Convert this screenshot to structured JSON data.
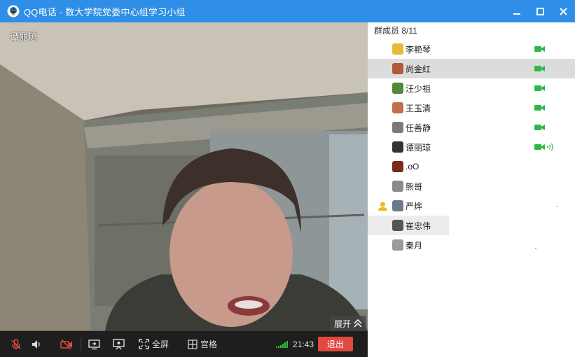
{
  "window": {
    "app": "QQ电话",
    "separator": " - ",
    "group": "数大学院党委中心组学习小组"
  },
  "video": {
    "speaker_name": "谭丽琼",
    "expand_label": "展开"
  },
  "toolbar": {
    "fullscreen_label": "全屏",
    "grid_label": "宫格",
    "time": "21:43",
    "exit_label": "退出"
  },
  "members": {
    "header": "群成员 8/11",
    "items": [
      {
        "name": "李艳琴",
        "camera": true,
        "speaking": false,
        "owner": false,
        "avatar_color": "#e8b938"
      },
      {
        "name": "尚金红",
        "camera": true,
        "speaking": false,
        "owner": false,
        "avatar_color": "#b35a3a"
      },
      {
        "name": "汪少祖",
        "camera": true,
        "speaking": false,
        "owner": false,
        "avatar_color": "#4f8a3a"
      },
      {
        "name": "王玉清",
        "camera": true,
        "speaking": false,
        "owner": false,
        "avatar_color": "#c0704a"
      },
      {
        "name": "任善静",
        "camera": true,
        "speaking": false,
        "owner": false,
        "avatar_color": "#7a7a7a"
      },
      {
        "name": "谭丽琼",
        "camera": true,
        "speaking": true,
        "owner": false,
        "avatar_color": "#333333"
      },
      {
        "name": ".oO",
        "camera": false,
        "speaking": false,
        "owner": false,
        "avatar_color": "#7a2a1a"
      },
      {
        "name": "熊哥",
        "camera": false,
        "speaking": false,
        "owner": false,
        "avatar_color": "#8a8a8a"
      },
      {
        "name": "严烨",
        "camera": false,
        "speaking": false,
        "owner": true,
        "avatar_color": "#6a7a8a"
      },
      {
        "name": "崔忠伟",
        "camera": false,
        "speaking": false,
        "owner": false,
        "avatar_color": "#555555"
      },
      {
        "name": "秦月",
        "camera": false,
        "speaking": false,
        "owner": false,
        "avatar_color": "#9a9a9a"
      }
    ]
  },
  "colors": {
    "titlebar": "#2f8ee6",
    "camera_on": "#2eb84a",
    "exit": "#e04a3f",
    "signal": "#27c43e"
  }
}
